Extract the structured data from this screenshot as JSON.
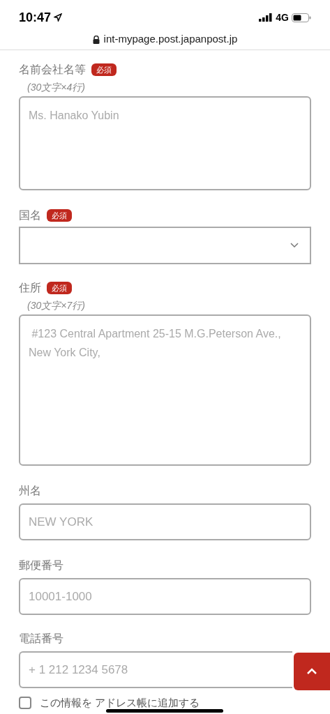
{
  "status_bar": {
    "time": "10:47",
    "network": "4G"
  },
  "address_bar": {
    "url": "int-mypage.post.japanpost.jp"
  },
  "fields": [
    {
      "kind": "textarea",
      "label": "名前会社名等",
      "required": true,
      "badge": "必須",
      "note": "(30文字×4行)",
      "placeholder": "Ms. Hanako Yubin"
    },
    {
      "kind": "select",
      "label": "国名",
      "required": true,
      "badge": "必須"
    },
    {
      "kind": "textarea",
      "label": "住所",
      "required": true,
      "badge": "必須",
      "note": "(30文字×7行)",
      "placeholder": " #123 Central Apartment 25-15 M.G.Peterson Ave., New York City,"
    },
    {
      "kind": "input",
      "label": "州名",
      "required": false,
      "placeholder": "NEW YORK"
    },
    {
      "kind": "input",
      "label": "郵便番号",
      "required": false,
      "placeholder": "10001-1000"
    },
    {
      "kind": "input",
      "label": "電話番号",
      "required": false,
      "placeholder": "+ 1 212 1234 5678"
    }
  ],
  "address_book_checkbox": {
    "label": "この情報を アドレス帳に追加する",
    "checked": false
  }
}
